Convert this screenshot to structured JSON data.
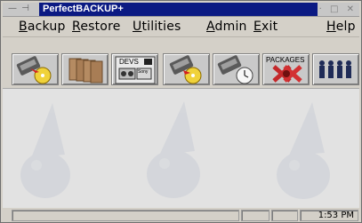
{
  "window": {
    "title": "PerfectBACKUP+",
    "left_controls": "— ⊣",
    "right_controls": [
      "·",
      "□",
      "✕"
    ]
  },
  "menu": {
    "items": [
      {
        "label": "Backup",
        "underline": "B"
      },
      {
        "label": "Restore",
        "underline": "R"
      },
      {
        "label": "Utilities",
        "underline": "U"
      },
      {
        "label": "Admin",
        "underline": "A"
      },
      {
        "label": "Exit",
        "underline": "E"
      },
      {
        "label": "Help",
        "underline": "H"
      }
    ]
  },
  "toolbar": {
    "buttons": [
      {
        "name": "backup-tape-to-disk",
        "icon": "tape-cd-icon"
      },
      {
        "name": "files",
        "icon": "folders-icon"
      },
      {
        "name": "devices",
        "icon": "devices-icon",
        "label": "DEVS",
        "sublabel": "Sony"
      },
      {
        "name": "restore-tape-to-disk",
        "icon": "tape-cd-icon"
      },
      {
        "name": "schedule",
        "icon": "tape-clock-icon"
      },
      {
        "name": "packages",
        "icon": "packages-icon",
        "label": "PACKAGES"
      },
      {
        "name": "users",
        "icon": "users-icon"
      }
    ]
  },
  "status": {
    "time": "1:53 PM"
  },
  "colors": {
    "titlebar": "#0b1a83",
    "background": "#d4d0c8",
    "workarea": "#e2e2e2"
  }
}
